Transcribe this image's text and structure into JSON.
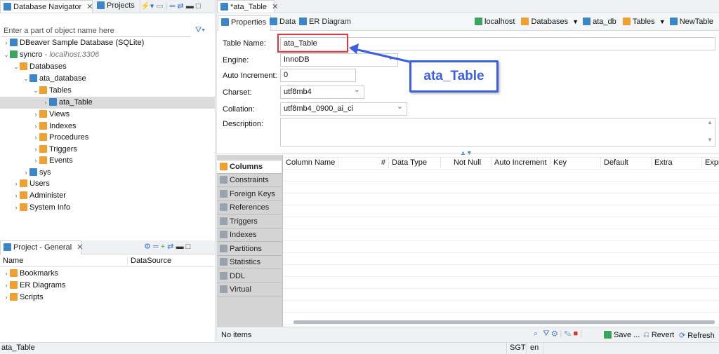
{
  "left_tabs": {
    "navigator": "Database Navigator",
    "projects": "Projects"
  },
  "filter": {
    "placeholder": "Enter a part of object name here"
  },
  "tree": {
    "dbeaver_sample": "DBeaver Sample Database (SQLite)",
    "syncro": "syncro",
    "syncro_host": "- localhost:3306",
    "databases": "Databases",
    "ata_database": "ata_database",
    "tables": "Tables",
    "ata_table": "ata_Table",
    "views": "Views",
    "indexes": "Indexes",
    "procedures": "Procedures",
    "triggers": "Triggers",
    "events": "Events",
    "sys": "sys",
    "users": "Users",
    "administer": "Administer",
    "system_info": "System Info"
  },
  "project_panel": {
    "title": "Project - General",
    "col_name": "Name",
    "col_datasource": "DataSource",
    "items": [
      "Bookmarks",
      "ER Diagrams",
      "Scripts"
    ]
  },
  "editor_tab": {
    "title": "*ata_Table"
  },
  "subtabs": {
    "properties": "Properties",
    "data": "Data",
    "er_diagram": "ER Diagram"
  },
  "breadcrumb": {
    "host": "localhost",
    "databases": "Databases",
    "db": "ata_db",
    "tables": "Tables",
    "table": "NewTable"
  },
  "form": {
    "table_name_label": "Table Name:",
    "table_name": "ata_Table",
    "engine_label": "Engine:",
    "engine": "InnoDB",
    "auto_inc_label": "Auto Increment:",
    "auto_inc": "0",
    "charset_label": "Charset:",
    "charset": "utf8mb4",
    "collation_label": "Collation:",
    "collation": "utf8mb4_0900_ai_ci",
    "description_label": "Description:"
  },
  "callout": {
    "text": "ata_Table",
    "color": "#3b5ee8",
    "highlight": "#e8343b"
  },
  "side_tabs": [
    "Columns",
    "Constraints",
    "Foreign Keys",
    "References",
    "Triggers",
    "Indexes",
    "Partitions",
    "Statistics",
    "DDL",
    "Virtual"
  ],
  "columns": [
    "Column Name",
    "#",
    "Data Type",
    "Not Null",
    "Auto Increment",
    "Key",
    "Default",
    "Extra",
    "Expr"
  ],
  "bottom_bar": {
    "status": "No items",
    "save": "Save ...",
    "revert": "Revert",
    "refresh": "Refresh"
  },
  "status_bar": {
    "selection": "ata_Table",
    "timezone": "SGT",
    "locale": "en"
  }
}
